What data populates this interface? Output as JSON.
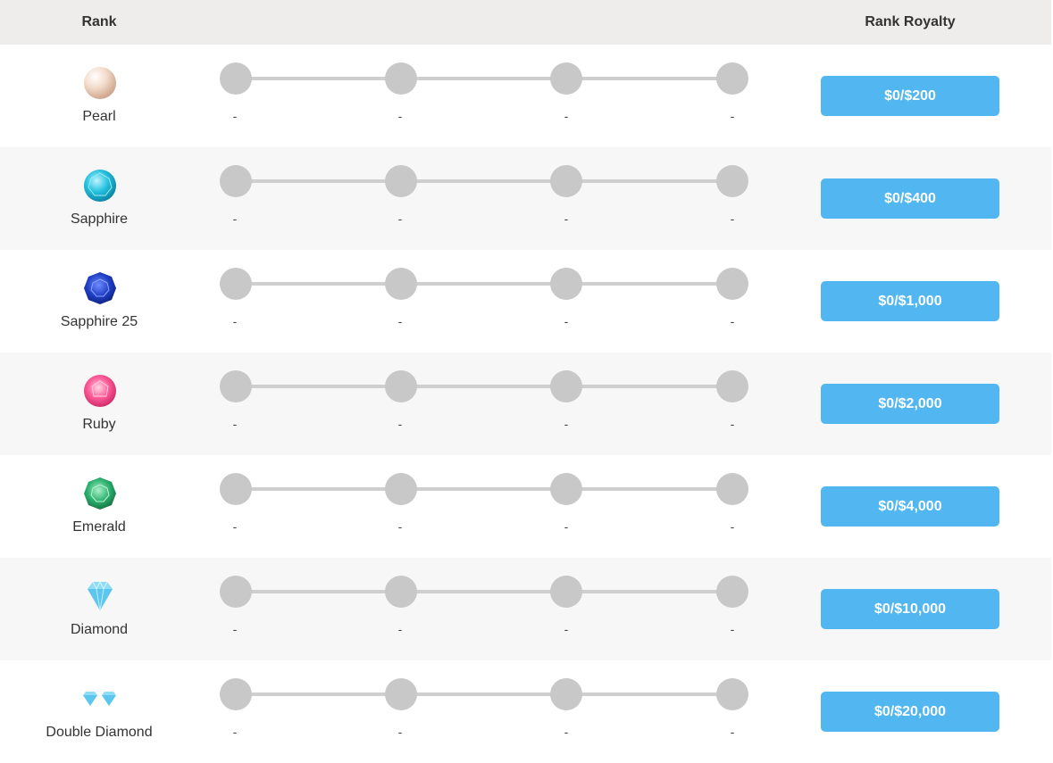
{
  "header": {
    "rank": "Rank",
    "royalty": "Rank Royalty"
  },
  "rows": [
    {
      "name": "Pearl",
      "gem": "pearl-icon",
      "royalty": "$0/$200",
      "steps": [
        "-",
        "-",
        "-",
        "-"
      ]
    },
    {
      "name": "Sapphire",
      "gem": "sapphire-icon",
      "royalty": "$0/$400",
      "steps": [
        "-",
        "-",
        "-",
        "-"
      ]
    },
    {
      "name": "Sapphire 25",
      "gem": "sapphire-25-icon",
      "royalty": "$0/$1,000",
      "steps": [
        "-",
        "-",
        "-",
        "-"
      ]
    },
    {
      "name": "Ruby",
      "gem": "ruby-icon",
      "royalty": "$0/$2,000",
      "steps": [
        "-",
        "-",
        "-",
        "-"
      ]
    },
    {
      "name": "Emerald",
      "gem": "emerald-icon",
      "royalty": "$0/$4,000",
      "steps": [
        "-",
        "-",
        "-",
        "-"
      ]
    },
    {
      "name": "Diamond",
      "gem": "diamond-icon",
      "royalty": "$0/$10,000",
      "steps": [
        "-",
        "-",
        "-",
        "-"
      ]
    },
    {
      "name": "Double Diamond",
      "gem": "double-diamond-icon",
      "royalty": "$0/$20,000",
      "steps": [
        "-",
        "-",
        "-",
        "-"
      ]
    }
  ],
  "colors": {
    "button": "#52b7f0",
    "dot": "#c8c8c8",
    "track": "#cfcfcf",
    "header_bg": "#eeedec",
    "alt_row": "#f7f7f7"
  }
}
